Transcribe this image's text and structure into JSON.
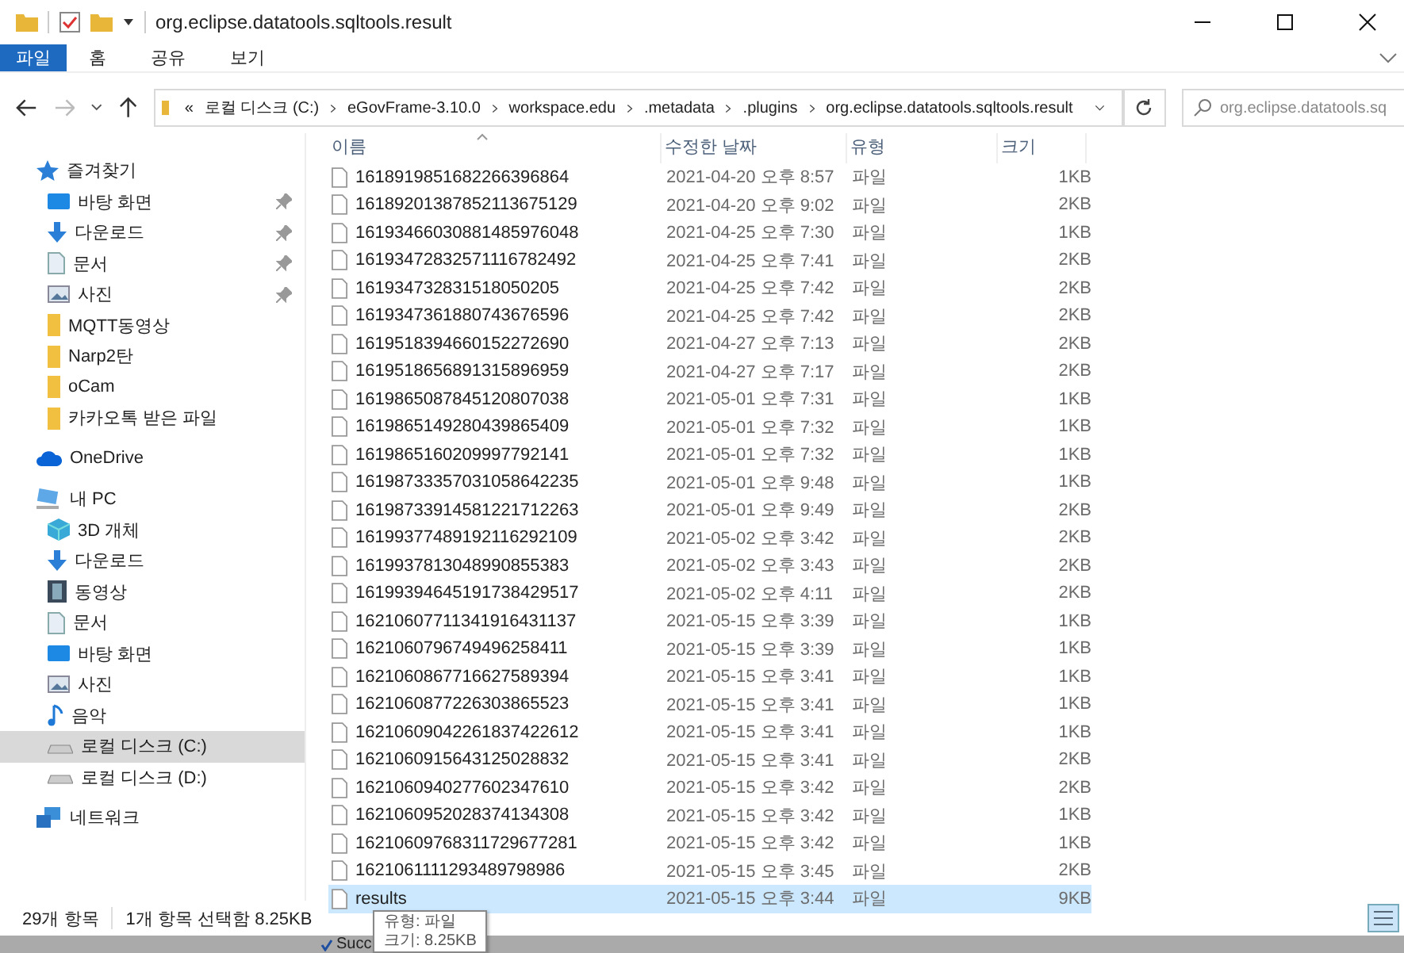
{
  "window": {
    "title": "org.eclipse.datatools.sqltools.result"
  },
  "ribbon_tabs": [
    {
      "label": "파일",
      "selected": true
    },
    {
      "label": "홈",
      "selected": false
    },
    {
      "label": "공유",
      "selected": false
    },
    {
      "label": "보기",
      "selected": false
    }
  ],
  "address": {
    "overflow": "«",
    "crumbs": [
      "로컬 디스크 (C:)",
      "eGovFrame-3.10.0",
      "workspace.edu",
      ".metadata",
      ".plugins",
      "org.eclipse.datatools.sqltools.result"
    ]
  },
  "search": {
    "placeholder": "org.eclipse.datatools.sq"
  },
  "sidebar": [
    {
      "label": "즐겨찾기",
      "kind": "star",
      "selected": false,
      "children": [
        {
          "label": "바탕 화면",
          "kind": "desktop",
          "pinned": true,
          "selected": false
        },
        {
          "label": "다운로드",
          "kind": "download",
          "pinned": true,
          "selected": false
        },
        {
          "label": "문서",
          "kind": "doc",
          "pinned": true,
          "selected": false
        },
        {
          "label": "사진",
          "kind": "picture",
          "pinned": true,
          "selected": false
        },
        {
          "label": "MQTT동영상",
          "kind": "folder",
          "pinned": false,
          "selected": false
        },
        {
          "label": "Narp2탄",
          "kind": "folder",
          "pinned": false,
          "selected": false
        },
        {
          "label": "oCam",
          "kind": "folder",
          "pinned": false,
          "selected": false
        },
        {
          "label": "카카오톡 받은 파일",
          "kind": "folder",
          "pinned": false,
          "selected": false
        }
      ]
    },
    {
      "label": "OneDrive",
      "kind": "cloud",
      "selected": false
    },
    {
      "label": "내 PC",
      "kind": "pc",
      "selected": false,
      "children": [
        {
          "label": "3D 개체",
          "kind": "cube",
          "pinned": false,
          "selected": false
        },
        {
          "label": "다운로드",
          "kind": "download",
          "pinned": false,
          "selected": false
        },
        {
          "label": "동영상",
          "kind": "video",
          "pinned": false,
          "selected": false
        },
        {
          "label": "문서",
          "kind": "doc",
          "pinned": false,
          "selected": false
        },
        {
          "label": "바탕 화면",
          "kind": "desktop",
          "pinned": false,
          "selected": false
        },
        {
          "label": "사진",
          "kind": "picture",
          "pinned": false,
          "selected": false
        },
        {
          "label": "음악",
          "kind": "music",
          "pinned": false,
          "selected": false
        },
        {
          "label": "로컬 디스크 (C:)",
          "kind": "drive",
          "pinned": false,
          "selected": true
        },
        {
          "label": "로컬 디스크 (D:)",
          "kind": "drive",
          "pinned": false,
          "selected": false
        }
      ]
    },
    {
      "label": "네트워크",
      "kind": "network",
      "selected": false
    }
  ],
  "table": {
    "columns": [
      "이름",
      "수정한 날짜",
      "유형",
      "크기"
    ],
    "rows": [
      {
        "name": "1618919851682266396864",
        "date": "2021-04-20 오후 8:57",
        "type": "파일",
        "size": "1KB",
        "selected": false
      },
      {
        "name": "16189201387852113675129",
        "date": "2021-04-20 오후 9:02",
        "type": "파일",
        "size": "2KB",
        "selected": false
      },
      {
        "name": "16193466030881485976048",
        "date": "2021-04-25 오후 7:30",
        "type": "파일",
        "size": "1KB",
        "selected": false
      },
      {
        "name": "16193472832571116782492",
        "date": "2021-04-25 오후 7:41",
        "type": "파일",
        "size": "2KB",
        "selected": false
      },
      {
        "name": "161934732831518050205",
        "date": "2021-04-25 오후 7:42",
        "type": "파일",
        "size": "2KB",
        "selected": false
      },
      {
        "name": "1619347361880743676596",
        "date": "2021-04-25 오후 7:42",
        "type": "파일",
        "size": "2KB",
        "selected": false
      },
      {
        "name": "1619518394660152272690",
        "date": "2021-04-27 오후 7:13",
        "type": "파일",
        "size": "2KB",
        "selected": false
      },
      {
        "name": "1619518656891315896959",
        "date": "2021-04-27 오후 7:17",
        "type": "파일",
        "size": "2KB",
        "selected": false
      },
      {
        "name": "1619865087845120807038",
        "date": "2021-05-01 오후 7:31",
        "type": "파일",
        "size": "1KB",
        "selected": false
      },
      {
        "name": "1619865149280439865409",
        "date": "2021-05-01 오후 7:32",
        "type": "파일",
        "size": "1KB",
        "selected": false
      },
      {
        "name": "1619865160209997792141",
        "date": "2021-05-01 오후 7:32",
        "type": "파일",
        "size": "1KB",
        "selected": false
      },
      {
        "name": "16198733357031058642235",
        "date": "2021-05-01 오후 9:48",
        "type": "파일",
        "size": "1KB",
        "selected": false
      },
      {
        "name": "16198733914581221712263",
        "date": "2021-05-01 오후 9:49",
        "type": "파일",
        "size": "2KB",
        "selected": false
      },
      {
        "name": "16199377489192116292109",
        "date": "2021-05-02 오후 3:42",
        "type": "파일",
        "size": "2KB",
        "selected": false
      },
      {
        "name": "1619937813048990855383",
        "date": "2021-05-02 오후 3:43",
        "type": "파일",
        "size": "2KB",
        "selected": false
      },
      {
        "name": "16199394645191738429517",
        "date": "2021-05-02 오후 4:11",
        "type": "파일",
        "size": "2KB",
        "selected": false
      },
      {
        "name": "16210607711341916431137",
        "date": "2021-05-15 오후 3:39",
        "type": "파일",
        "size": "1KB",
        "selected": false
      },
      {
        "name": "1621060796749496258411",
        "date": "2021-05-15 오후 3:39",
        "type": "파일",
        "size": "1KB",
        "selected": false
      },
      {
        "name": "1621060867716627589394",
        "date": "2021-05-15 오후 3:41",
        "type": "파일",
        "size": "1KB",
        "selected": false
      },
      {
        "name": "1621060877226303865523",
        "date": "2021-05-15 오후 3:41",
        "type": "파일",
        "size": "1KB",
        "selected": false
      },
      {
        "name": "16210609042261837422612",
        "date": "2021-05-15 오후 3:41",
        "type": "파일",
        "size": "1KB",
        "selected": false
      },
      {
        "name": "1621060915643125028832",
        "date": "2021-05-15 오후 3:41",
        "type": "파일",
        "size": "2KB",
        "selected": false
      },
      {
        "name": "1621060940277602347610",
        "date": "2021-05-15 오후 3:42",
        "type": "파일",
        "size": "2KB",
        "selected": false
      },
      {
        "name": "1621060952028374134308",
        "date": "2021-05-15 오후 3:42",
        "type": "파일",
        "size": "1KB",
        "selected": false
      },
      {
        "name": "16210609768311729677281",
        "date": "2021-05-15 오후 3:42",
        "type": "파일",
        "size": "1KB",
        "selected": false
      },
      {
        "name": "1621061111293489798986",
        "date": "2021-05-15 오후 3:45",
        "type": "파일",
        "size": "2KB",
        "selected": false
      },
      {
        "name": "results",
        "date": "2021-05-15 오후 3:44",
        "type": "파일",
        "size": "9KB",
        "selected": true
      }
    ]
  },
  "tooltip": [
    "유형: 파일",
    "크기: 8.25KB"
  ],
  "status_bar": {
    "count": "29개 항목",
    "selection": "1개 항목 선택함 8.25KB"
  },
  "background_app": {
    "status": "Succ"
  }
}
